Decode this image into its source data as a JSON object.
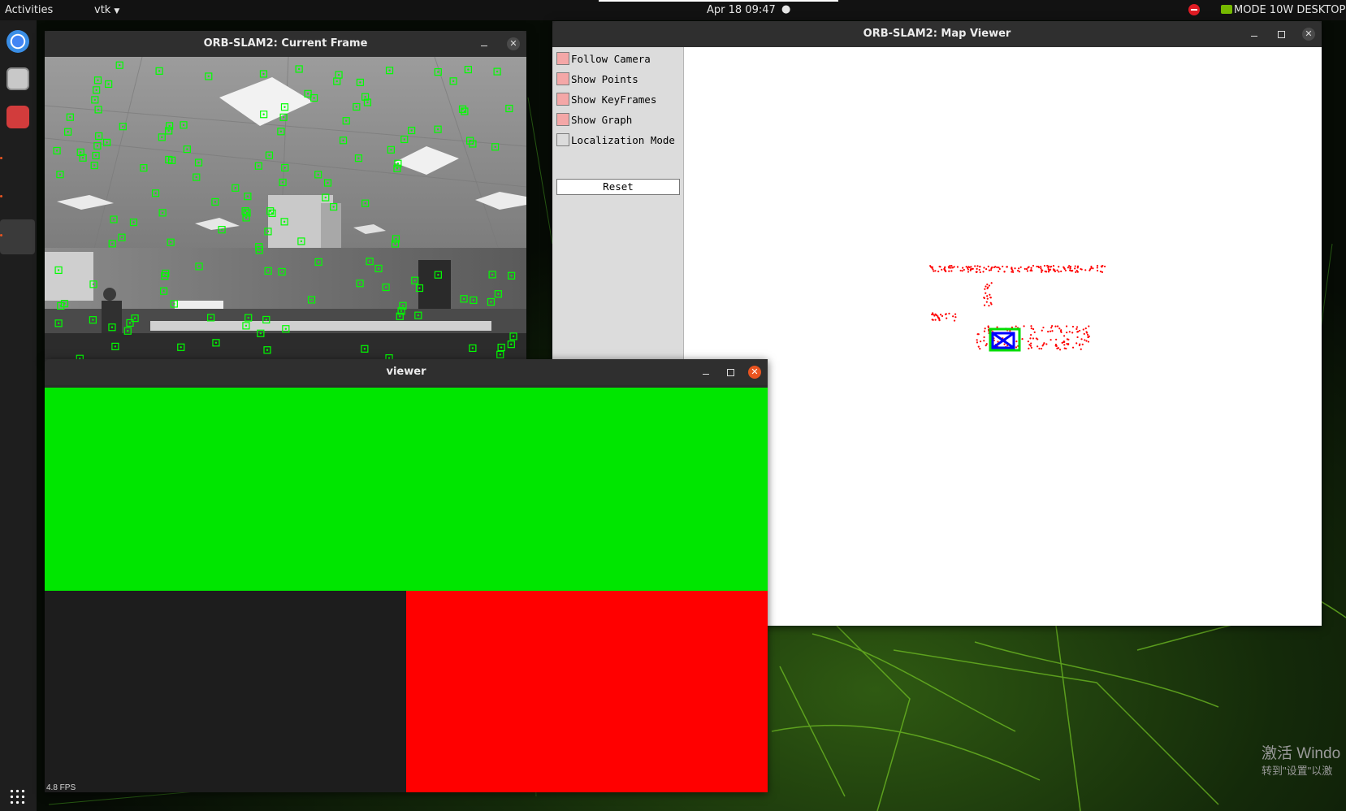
{
  "topbar": {
    "activities": "Activities",
    "app_menu": "vtk",
    "clock": "Apr 18  09:47",
    "status_dot": "●",
    "mode": "MODE 10W DESKTOP"
  },
  "dock": {
    "icons": [
      "chrome-icon",
      "files-icon",
      "video-icon",
      "show-apps-icon"
    ]
  },
  "current_frame": {
    "title": "ORB-SLAM2: Current Frame",
    "scene": "grayscale office image with green ORB feature boxes"
  },
  "map_viewer": {
    "title": "ORB-SLAM2: Map Viewer",
    "options": [
      {
        "label": "Follow Camera",
        "checked": true
      },
      {
        "label": "Show Points",
        "checked": true
      },
      {
        "label": "Show KeyFrames",
        "checked": true
      },
      {
        "label": "Show Graph",
        "checked": true
      },
      {
        "label": "Localization Mode",
        "checked": false
      }
    ],
    "reset_label": "Reset"
  },
  "viewer": {
    "title": "viewer",
    "fps": "4.8 FPS"
  },
  "watermark": {
    "line1": "激活 Windo",
    "line2": "转到\"设置\"以激"
  },
  "colors": {
    "feature": "#00ff00",
    "map_point": "#ff0000",
    "keyframe": "#0000ff",
    "current_camera": "#00dd00",
    "viewer_top": "#00e600",
    "viewer_bottom_left": "#1d1d1d",
    "viewer_bottom_right": "#ff0000",
    "ubuntu_orange": "#e95420"
  }
}
